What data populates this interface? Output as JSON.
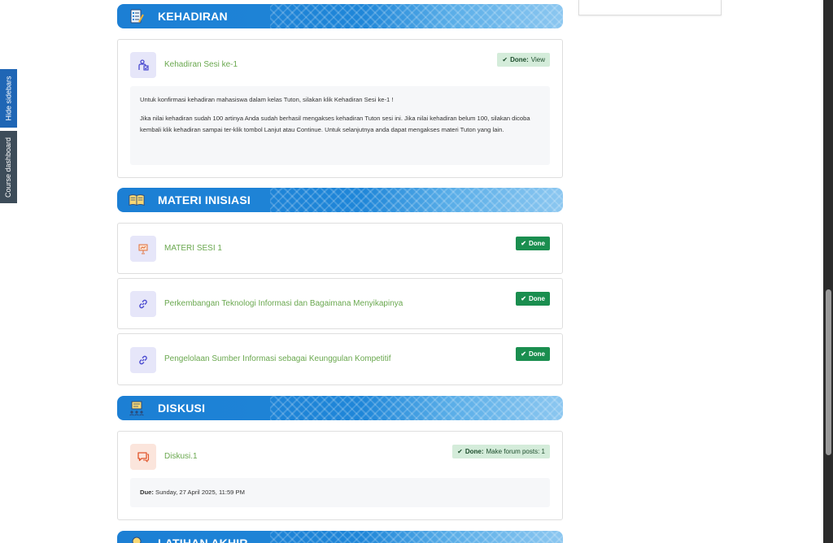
{
  "sidebar_tabs": {
    "hide_sidebars": "Hide sidebars",
    "course_dashboard": "Course dashboard"
  },
  "sections": {
    "kehadiran": {
      "title": "KEHADIRAN",
      "activity": {
        "name": "Kehadiran Sesi ke-1",
        "badge_strong": "Done:",
        "badge_text": "View",
        "description": [
          "Untuk konfirmasi kehadiran mahasiswa dalam kelas Tuton, silakan klik Kehadiran Sesi ke-1 !",
          "Jika nilai kehadiran sudah 100 artinya Anda sudah berhasil mengakses kehadiran Tuton sesi ini. Jika nilai kehadiran belum 100, silakan dicoba kembali klik kehadiran sampai ter-klik tombol Lanjut atau Continue. Untuk selanjutnya anda dapat mengakses materi Tuton yang lain."
        ]
      }
    },
    "materi": {
      "title": "MATERI INISIASI",
      "activities": [
        {
          "name": "MATERI SESI 1",
          "badge": "Done"
        },
        {
          "name": "Perkembangan Teknologi Informasi dan Bagaimana Menyikapinya",
          "badge": "Done"
        },
        {
          "name": "Pengelolaan Sumber Informasi sebagai Keunggulan Kompetitif",
          "badge": "Done"
        }
      ]
    },
    "diskusi": {
      "title": "DISKUSI",
      "activity": {
        "name": "Diskusi.1",
        "badge_strong": "Done:",
        "badge_text": "Make forum posts: 1",
        "due_label": "Due:",
        "due_value": "Sunday, 27 April 2025, 11:59 PM"
      }
    },
    "latihan": {
      "title": "LATIHAN AKHIR"
    }
  },
  "colors": {
    "header_blue": "#1c7fd4",
    "link_green": "#6aa84f",
    "done_green": "#1a8e4f"
  }
}
